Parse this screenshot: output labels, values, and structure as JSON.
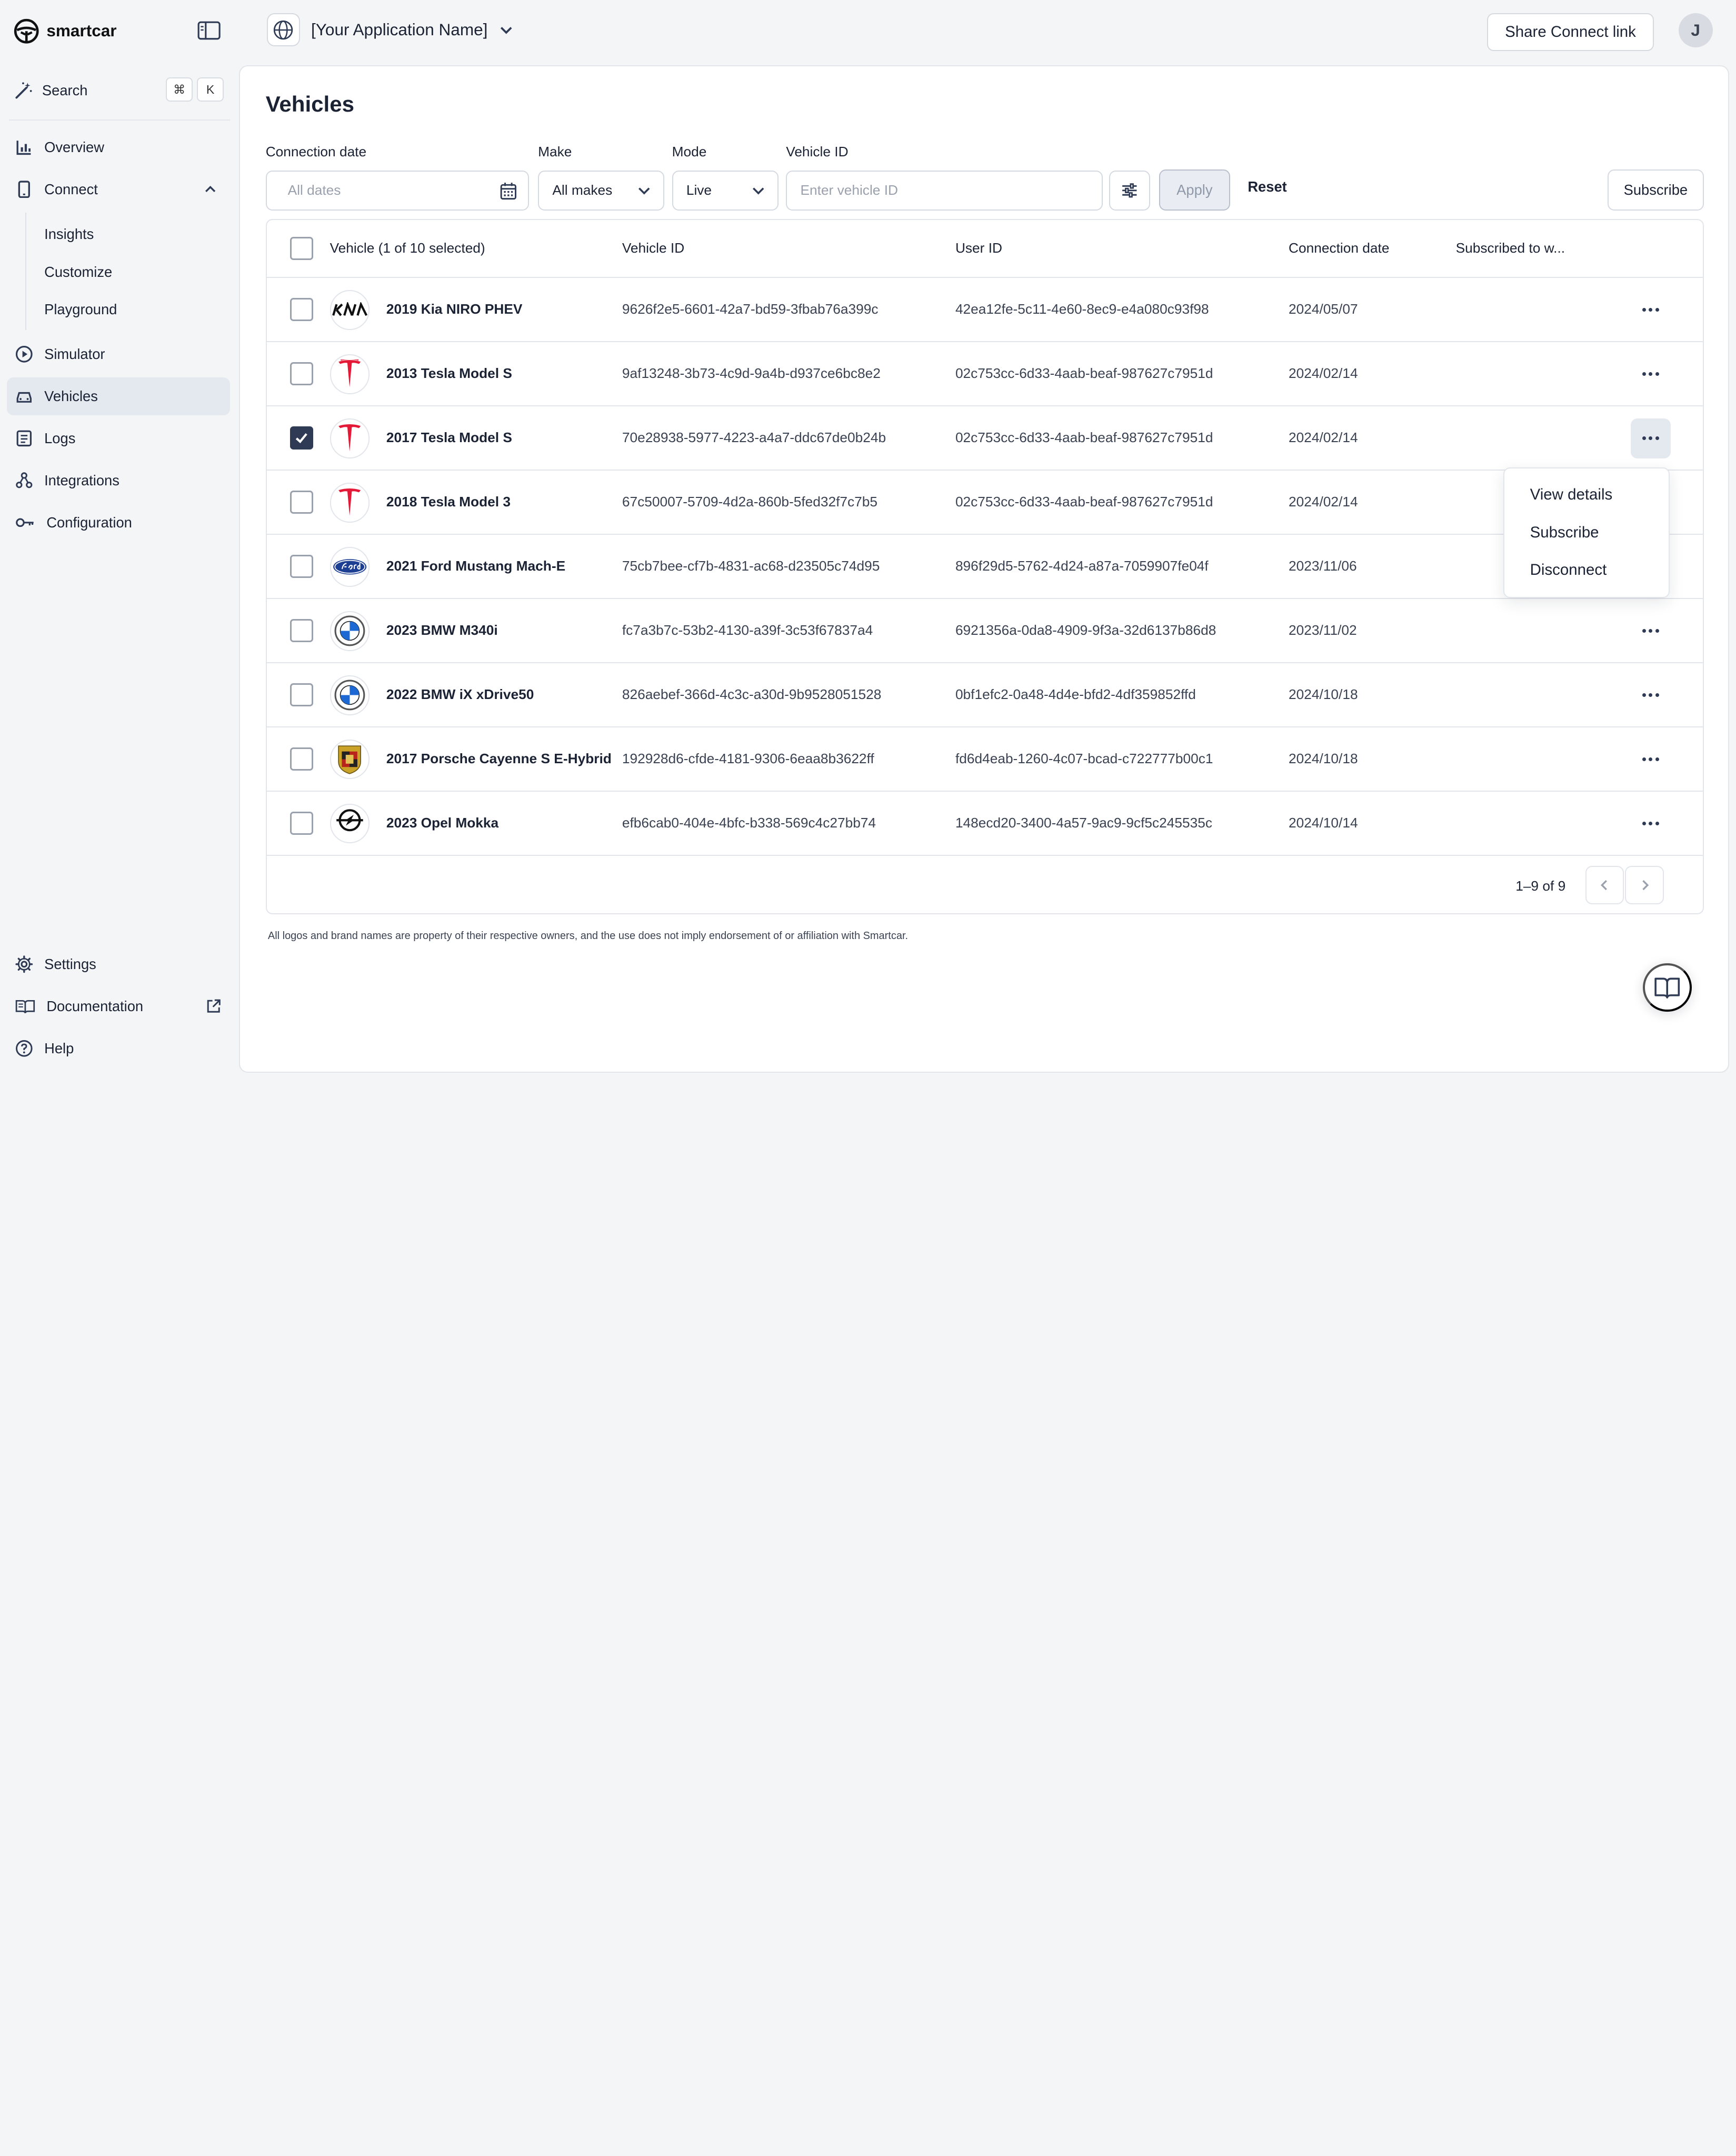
{
  "brand": {
    "name": "smartcar"
  },
  "sidebar": {
    "search_label": "Search",
    "shortcut_keys": [
      "⌘",
      "K"
    ],
    "items": [
      {
        "label": "Overview",
        "icon": "bar-chart-icon"
      },
      {
        "label": "Connect",
        "icon": "phone-icon"
      },
      {
        "label": "Simulator",
        "icon": "play-circle-icon"
      },
      {
        "label": "Vehicles",
        "icon": "car-icon",
        "active": true
      },
      {
        "label": "Logs",
        "icon": "list-icon"
      },
      {
        "label": "Integrations",
        "icon": "integrations-icon"
      },
      {
        "label": "Configuration",
        "icon": "key-icon"
      }
    ],
    "connect_sub": [
      "Insights",
      "Customize",
      "Playground"
    ],
    "bottom": [
      {
        "label": "Settings",
        "icon": "gear-icon"
      },
      {
        "label": "Documentation",
        "icon": "book-icon"
      },
      {
        "label": "Help",
        "icon": "help-circle-icon"
      }
    ]
  },
  "topbar": {
    "app_name": "[Your Application Name]",
    "share_label": "Share Connect link",
    "avatar_initial": "J"
  },
  "page": {
    "title": "Vehicles",
    "filters": {
      "connection_date": {
        "label": "Connection date",
        "placeholder": "All dates"
      },
      "make": {
        "label": "Make",
        "value": "All makes"
      },
      "mode": {
        "label": "Mode",
        "value": "Live"
      },
      "vehicle_id": {
        "label": "Vehicle ID",
        "placeholder": "Enter vehicle ID"
      }
    },
    "apply_label": "Apply",
    "reset_label": "Reset",
    "subscribe_label": "Subscribe"
  },
  "table": {
    "headers": {
      "vehicle": "Vehicle (1 of 10 selected)",
      "vehicle_id": "Vehicle ID",
      "user_id": "User ID",
      "connection_date": "Connection date",
      "subscribed": "Subscribed to w..."
    },
    "rows": [
      {
        "name": "2019 Kia NIRO PHEV",
        "brand": "kia",
        "vehicle_id": "9626f2e5-6601-42a7-bd59-3fbab76a399c",
        "user_id": "42ea12fe-5c11-4e60-8ec9-e4a080c93f98",
        "date": "2024/05/07",
        "checked": false
      },
      {
        "name": "2013 Tesla Model S",
        "brand": "tesla",
        "vehicle_id": "9af13248-3b73-4c9d-9a4b-d937ce6bc8e2",
        "user_id": "02c753cc-6d33-4aab-beaf-987627c7951d",
        "date": "2024/02/14",
        "checked": false
      },
      {
        "name": "2017 Tesla Model S",
        "brand": "tesla",
        "vehicle_id": "70e28938-5977-4223-a4a7-ddc67de0b24b",
        "user_id": "02c753cc-6d33-4aab-beaf-987627c7951d",
        "date": "2024/02/14",
        "checked": true
      },
      {
        "name": "2018 Tesla Model 3",
        "brand": "tesla",
        "vehicle_id": "67c50007-5709-4d2a-860b-5fed32f7c7b5",
        "user_id": "02c753cc-6d33-4aab-beaf-987627c7951d",
        "date": "2024/02/14",
        "checked": false
      },
      {
        "name": "2021 Ford Mustang Mach-E",
        "brand": "ford",
        "vehicle_id": "75cb7bee-cf7b-4831-ac68-d23505c74d95",
        "user_id": "896f29d5-5762-4d24-a87a-7059907fe04f",
        "date": "2023/11/06",
        "checked": false
      },
      {
        "name": "2023 BMW M340i",
        "brand": "bmw",
        "vehicle_id": "fc7a3b7c-53b2-4130-a39f-3c53f67837a4",
        "user_id": "6921356a-0da8-4909-9f3a-32d6137b86d8",
        "date": "2023/11/02",
        "checked": false
      },
      {
        "name": "2022 BMW iX xDrive50",
        "brand": "bmw",
        "vehicle_id": "826aebef-366d-4c3c-a30d-9b9528051528",
        "user_id": "0bf1efc2-0a48-4d4e-bfd2-4df359852ffd",
        "date": "2024/10/18",
        "checked": false
      },
      {
        "name": "2017 Porsche Cayenne S E-Hybrid",
        "brand": "porsche",
        "vehicle_id": "192928d6-cfde-4181-9306-6eaa8b3622ff",
        "user_id": "fd6d4eab-1260-4c07-bcad-c722777b00c1",
        "date": "2024/10/18",
        "checked": false
      },
      {
        "name": "2023 Opel Mokka",
        "brand": "opel",
        "vehicle_id": "efb6cab0-404e-4bfc-b338-569c4c27bb74",
        "user_id": "148ecd20-3400-4a57-9ac9-9cf5c245535c",
        "date": "2024/10/14",
        "checked": false
      }
    ],
    "pagination": "1–9 of 9"
  },
  "row_menu": {
    "items": [
      "View details",
      "Subscribe",
      "Disconnect"
    ]
  },
  "footnote": "All logos and brand names are property of their respective owners, and the use does not imply endorsement of or affiliation with Smartcar.",
  "colors": {
    "accent": "#2f3b55",
    "tesla_red": "#e31937",
    "ford_blue": "#1c3f94",
    "bmw_blue": "#1c69d4"
  }
}
